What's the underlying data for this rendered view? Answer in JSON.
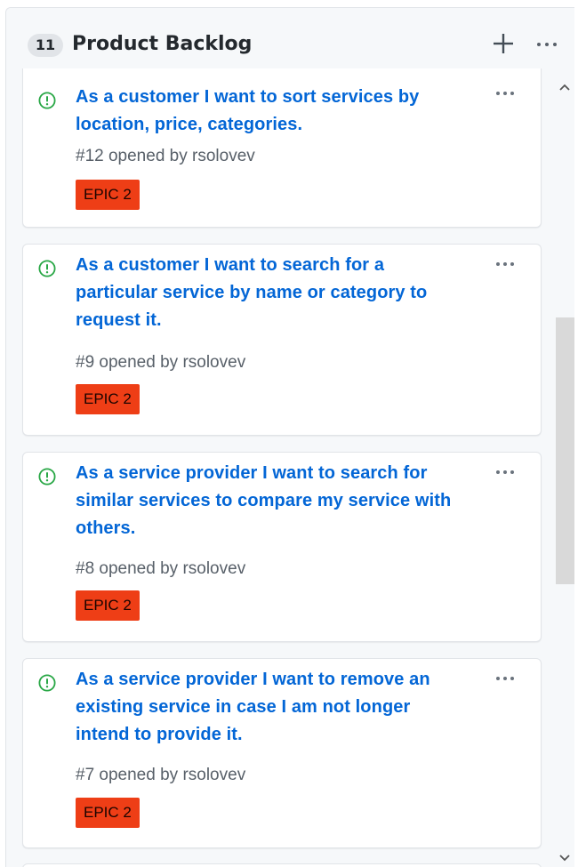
{
  "column": {
    "count": "11",
    "title": "Product Backlog"
  },
  "icons": {
    "header_add": "plus-icon",
    "header_more": "kebab-horizontal-icon",
    "issue": "issue-opened-icon",
    "card_more": "kebab-horizontal-icon",
    "scroll_up": "chevron-up-icon",
    "scroll_down": "chevron-down-icon"
  },
  "colors": {
    "issue_open": "#28a745",
    "link": "#0366d6",
    "label_epic": "#ee3e16"
  },
  "cards": [
    {
      "title": "As a customer I want to sort services by location, price, categories.",
      "meta": "#12 opened by rsolovev",
      "label": "EPIC 2"
    },
    {
      "title": "As a customer I want to search for a particular service by name or category to request it.",
      "meta": "#9 opened by rsolovev",
      "label": "EPIC 2"
    },
    {
      "title": "As a service provider I want to search for similar services to compare my service with others.",
      "meta": "#8 opened by rsolovev",
      "label": "EPIC 2"
    },
    {
      "title": "As a service provider I want to remove an existing service in case I am not longer intend to provide it.",
      "meta": "#7 opened by rsolovev",
      "label": "EPIC 2"
    }
  ]
}
